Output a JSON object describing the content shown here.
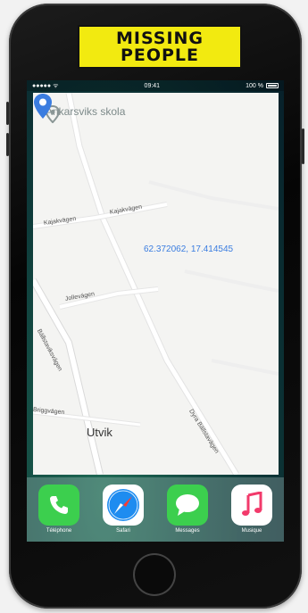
{
  "brand": {
    "line1": "MISSING",
    "line2": "PEOPLE"
  },
  "statusbar": {
    "carrier": "●●●●● ᯤ",
    "time": "09:41",
    "battery": "100 %"
  },
  "map": {
    "poi": {
      "label": "Ankarsviks skola",
      "icon": "location-pin-icon"
    },
    "pin": {
      "coordinates": "62.372062, 17.414545",
      "color": "#3b7de0"
    },
    "streets": [
      "Kajakvägen",
      "Kajakvägen",
      "Jollevägen",
      "Bällstaviksvägen",
      "Briggvägen",
      "Dyra Bällstavägen"
    ],
    "town": "Utvik"
  },
  "dock": [
    {
      "name": "Téléphone",
      "icon": "phone-icon",
      "color": "#3ccf4e"
    },
    {
      "name": "Safari",
      "icon": "compass-icon",
      "color": "#1e8cf0"
    },
    {
      "name": "Messages",
      "icon": "speech-bubble-icon",
      "color": "#3ccf4e"
    },
    {
      "name": "Musique",
      "icon": "music-note-icon",
      "color": "#ffffff"
    }
  ]
}
